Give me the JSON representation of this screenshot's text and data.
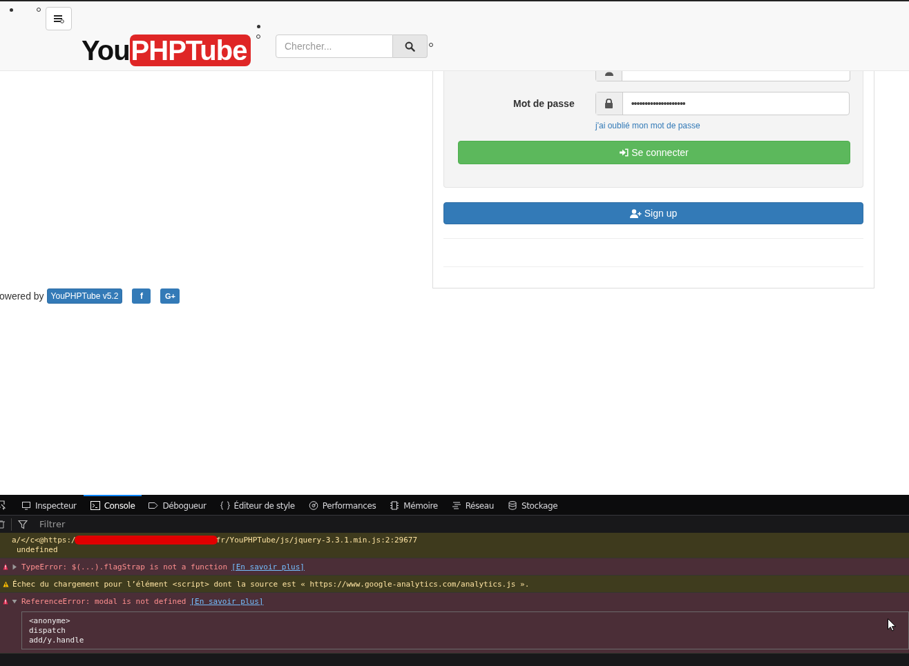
{
  "header": {
    "logo": {
      "part_1": "You",
      "part_2": "PHPTube"
    },
    "search": {
      "placeholder": "Chercher..."
    }
  },
  "login": {
    "fields": [
      {
        "kind": "user"
      },
      {
        "label": "Mot de passe",
        "value": "••••••••••••••••••••",
        "kind": "password"
      }
    ],
    "forgot_link": "j'ai oublié mon mot de passe",
    "submit": "Se connecter",
    "signup": "Sign up"
  },
  "footer": {
    "text": "owered by",
    "badge": "YouPHPTube v5.2",
    "social": [
      {
        "kind": "facebook",
        "glyph": "f"
      },
      {
        "kind": "google-plus",
        "glyph": "G+"
      }
    ]
  },
  "devtools": {
    "tabs": [
      {
        "label": "Inspecteur",
        "kind": "inspector",
        "selected": false
      },
      {
        "label": "Console",
        "kind": "console",
        "selected": true
      },
      {
        "label": "Débogueur",
        "kind": "debugger",
        "selected": false
      },
      {
        "label": "Éditeur de style",
        "kind": "style",
        "selected": false
      },
      {
        "label": "Performances",
        "kind": "performance",
        "selected": false
      },
      {
        "label": "Mémoire",
        "kind": "memory",
        "selected": false
      },
      {
        "label": "Réseau",
        "kind": "network",
        "selected": false
      },
      {
        "label": "Stockage",
        "kind": "storage",
        "selected": false
      }
    ],
    "filter": {
      "placeholder": "Filtrer"
    },
    "messages": [
      {
        "kind": "log",
        "text_before": "a/</c<@https:/",
        "redacted": true,
        "text_after": "fr/YouPHPTube/js/jquery-3.3.1.min.js:2:29677",
        "result": "undefined"
      },
      {
        "kind": "error",
        "expanded": false,
        "text": "TypeError: $(...).flagStrap is not a function",
        "link": "[En savoir plus]"
      },
      {
        "kind": "warning",
        "text": "Échec du chargement pour l’élément <script> dont la source est « https://www.google-analytics.com/analytics.js »."
      },
      {
        "kind": "error",
        "expanded": true,
        "text": "ReferenceError: modal is not defined",
        "link": "[En savoir plus]",
        "stack": [
          "<anonyme>",
          "dispatch",
          "add/y.handle"
        ]
      }
    ]
  }
}
